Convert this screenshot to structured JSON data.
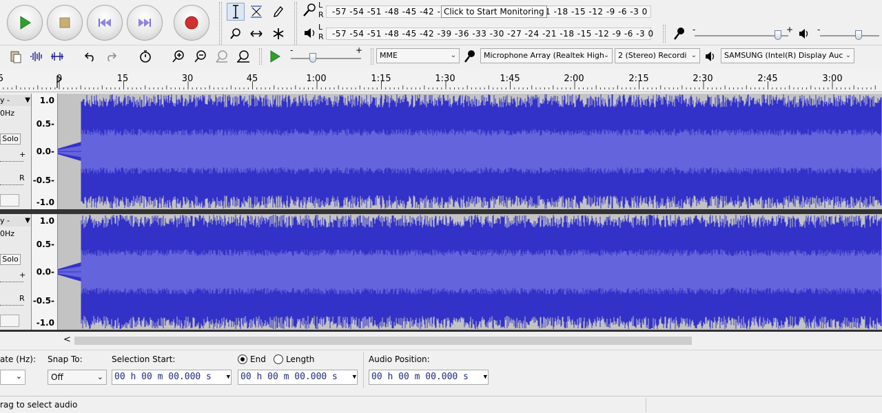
{
  "meters": {
    "recording_scale": "-57 -54 -51 -48 -45 -42 -3",
    "recording_scale_tail": "21 -18 -15 -12 -9 -6 -3 0",
    "tooltip": "Click to Start Monitoring",
    "playback_scale": "-57 -54 -51 -48 -45 -42 -39 -36 -33 -30 -27 -24 -21 -18 -15 -12 -9 -6 -3 0",
    "channel_l": "L",
    "channel_r": "R",
    "playback_speed_min": "-",
    "playback_speed_max": "+"
  },
  "device_toolbar": {
    "host": "MME",
    "recording_device": "Microphone Array (Realtek High",
    "recording_channels": "2 (Stereo) Recordi",
    "playback_device": "SAMSUNG (Intel(R) Display Auc"
  },
  "ruler": {
    "labels": [
      "5",
      "0",
      "15",
      "30",
      "45",
      "1:00",
      "1:15",
      "1:30",
      "1:45",
      "2:00",
      "2:15",
      "2:30",
      "2:45",
      "3:00"
    ]
  },
  "tracks": [
    {
      "name": "y -",
      "rate": "0Hz",
      "solo": "Solo",
      "pan_plus": "+",
      "pan_r": "R",
      "scale": [
        "1.0",
        "0.5-",
        "0.0-",
        "-0.5-",
        "-1.0"
      ]
    },
    {
      "name": "y -",
      "rate": "0Hz",
      "solo": "Solo",
      "pan_plus": "+",
      "pan_r": "R",
      "scale": [
        "1.0",
        "0.5-",
        "0.0-",
        "-0.5-",
        "-1.0"
      ]
    }
  ],
  "selection_toolbar": {
    "rate_label": "ate (Hz):",
    "snap_label": "Snap To:",
    "snap_value": "Off",
    "start_label": "Selection Start:",
    "end_label": "End",
    "length_label": "Length",
    "position_label": "Audio Position:",
    "time_start": "00 h 00 m 00.000 s",
    "time_end": "00 h 00 m 00.000 s",
    "time_position": "00 h 00 m 00.000 s"
  },
  "status": {
    "text": "rag to select audio"
  },
  "colors": {
    "waveform": "#3232c8",
    "waveform_rms": "#6464dc",
    "track_bg": "#c3c3c3",
    "record": "#d03030",
    "play": "#2ea02e"
  }
}
